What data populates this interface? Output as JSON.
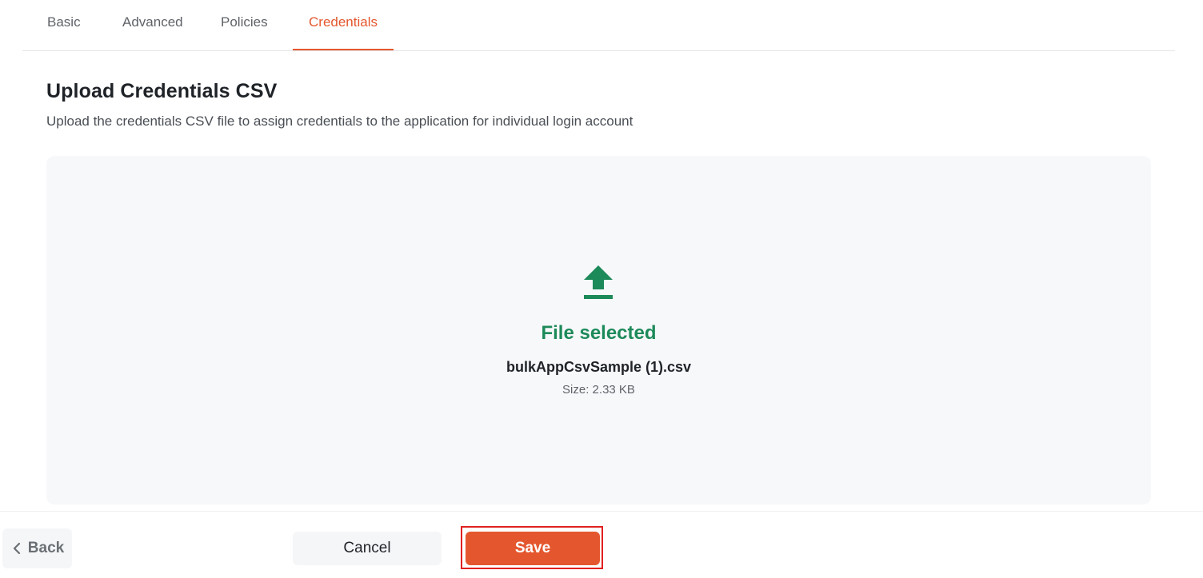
{
  "tabs": [
    {
      "label": "Basic",
      "active": false
    },
    {
      "label": "Advanced",
      "active": false
    },
    {
      "label": "Policies",
      "active": false
    },
    {
      "label": "Credentials",
      "active": true
    }
  ],
  "section": {
    "title": "Upload Credentials CSV",
    "subtitle": "Upload the credentials CSV file to assign credentials to the application for individual login account"
  },
  "upload": {
    "icon": "upload-icon",
    "status": "File selected",
    "file_name": "bulkAppCsvSample (1).csv",
    "file_size": "Size: 2.33 KB"
  },
  "footer": {
    "back_label": "Back",
    "cancel_label": "Cancel",
    "save_label": "Save"
  },
  "colors": {
    "accent": "#e4572e",
    "success": "#1d8a5a",
    "highlight_outline": "#e02020"
  }
}
